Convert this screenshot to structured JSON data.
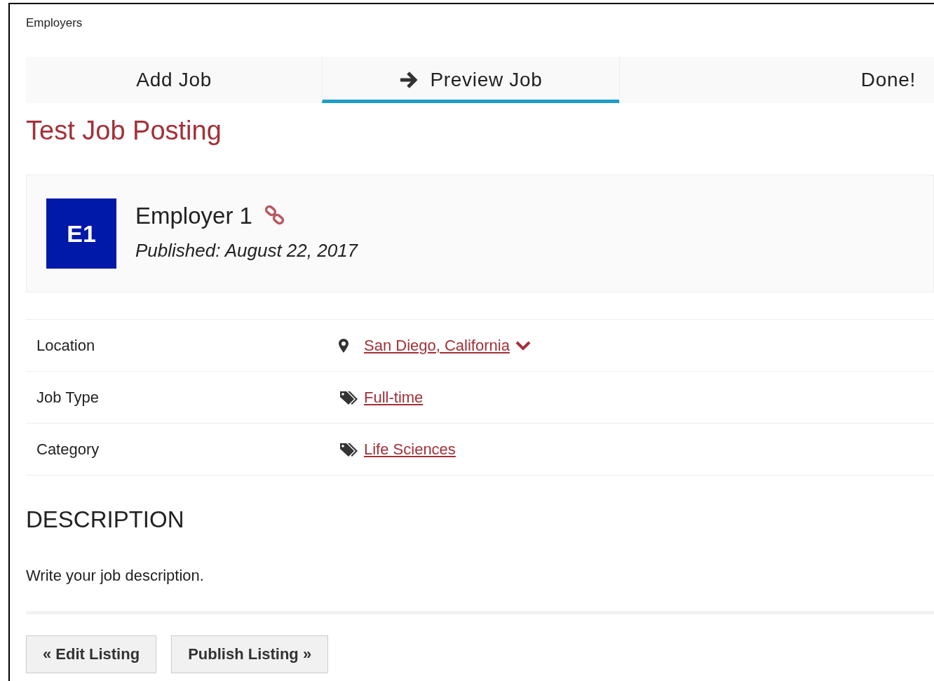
{
  "breadcrumb": "Employers",
  "steps": [
    {
      "label": "Add Job",
      "selected": false
    },
    {
      "label": "Preview Job",
      "selected": true
    },
    {
      "label": "Done!",
      "selected": false
    }
  ],
  "title": "Test Job Posting",
  "employer": {
    "initials": "E1",
    "name": "Employer 1",
    "published": "Published: August 22, 2017"
  },
  "details": [
    {
      "label": "Location",
      "kind": "pin",
      "value": "San Diego, California",
      "expandable": true
    },
    {
      "label": "Job Type",
      "kind": "tags",
      "value": "Full-time",
      "expandable": false
    },
    {
      "label": "Category",
      "kind": "tags",
      "value": "Life Sciences",
      "expandable": false
    }
  ],
  "description": {
    "heading": "DESCRIPTION",
    "text": "Write your job description."
  },
  "buttons": [
    "« Edit Listing",
    "Publish Listing »"
  ]
}
